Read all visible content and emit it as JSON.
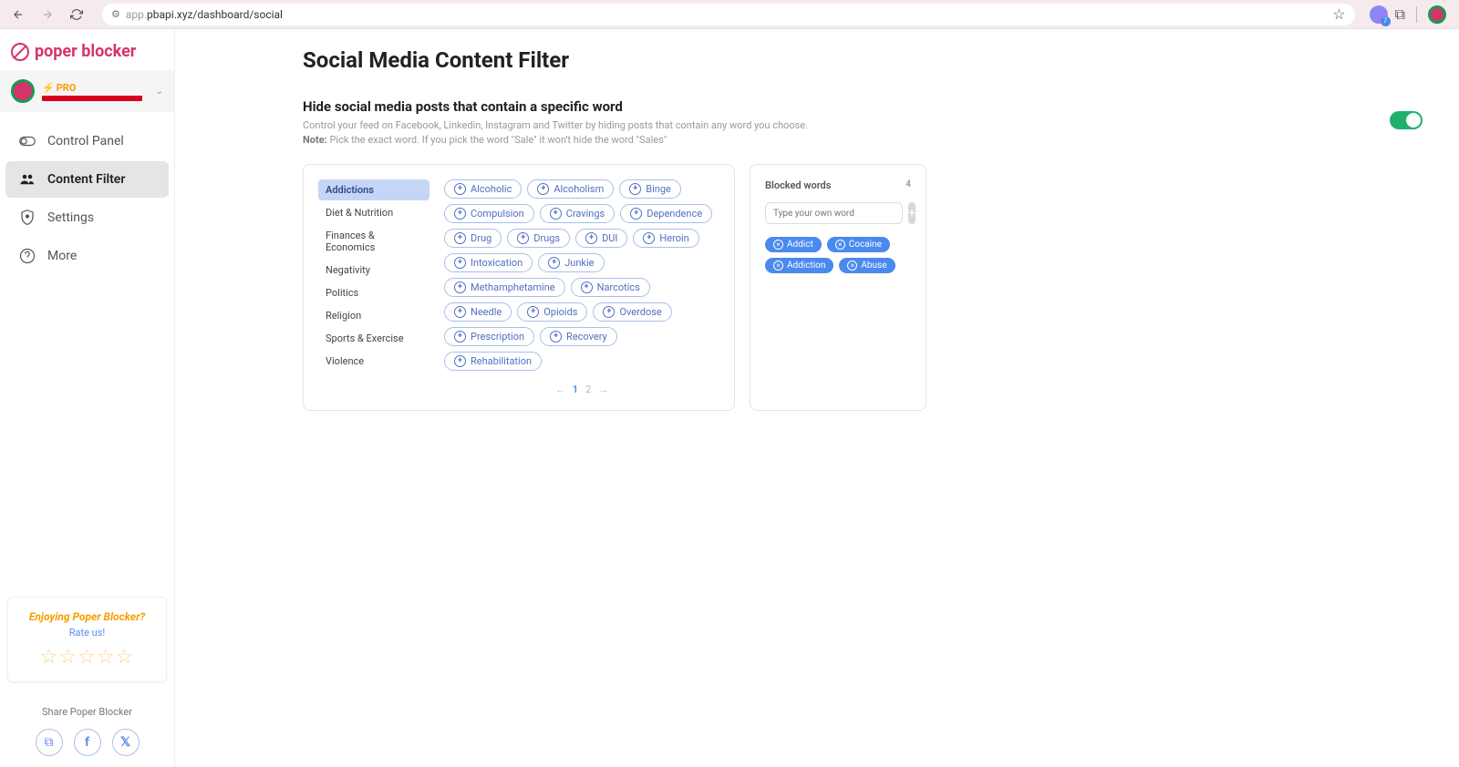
{
  "browser": {
    "url_prefix": "app.",
    "url": "pbapi.xyz/dashboard/social"
  },
  "logo_text": "poper blocker",
  "account": {
    "plan": "PRO"
  },
  "nav": [
    {
      "label": "Control Panel",
      "active": false
    },
    {
      "label": "Content Filter",
      "active": true
    },
    {
      "label": "Settings",
      "active": false
    },
    {
      "label": "More",
      "active": false
    }
  ],
  "page_title": "Social Media Content Filter",
  "hide": {
    "heading": "Hide social media posts that contain a specific word",
    "desc": "Control your feed on Facebook, Linkedin, Instagram and Twitter by hiding posts that contain any word you choose.",
    "note_label": "Note:",
    "note_text": "Pick the exact word. If you pick the word \"Sale\" it won't hide the word \"Sales\""
  },
  "categories": [
    "Addictions",
    "Diet & Nutrition",
    "Finances & Economics",
    "Negativity",
    "Politics",
    "Religion",
    "Sports & Exercise",
    "Violence"
  ],
  "active_category_index": 0,
  "words": [
    "Alcoholic",
    "Alcoholism",
    "Binge",
    "Compulsion",
    "Cravings",
    "Dependence",
    "Drug",
    "Drugs",
    "DUI",
    "Heroin",
    "Intoxication",
    "Junkie",
    "Methamphetamine",
    "Narcotics",
    "Needle",
    "Opioids",
    "Overdose",
    "Prescription",
    "Recovery",
    "Rehabilitation"
  ],
  "pagination": {
    "current": "1",
    "other": "2"
  },
  "blocked": {
    "title": "Blocked words",
    "count": "4",
    "placeholder": "Type your own word",
    "items": [
      "Addict",
      "Cocaine",
      "Addiction",
      "Abuse"
    ]
  },
  "rating": {
    "title": "Enjoying Poper Blocker?",
    "sub": "Rate us!"
  },
  "share_label": "Share Poper Blocker"
}
